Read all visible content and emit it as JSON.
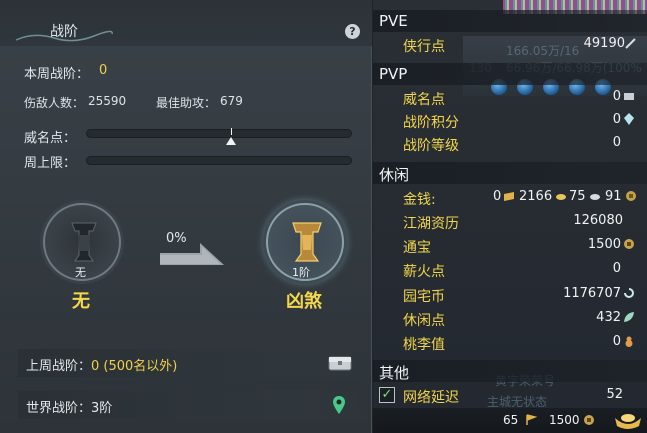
{
  "left": {
    "title": "战阶",
    "help_label": "?",
    "weekly_rank_label": "本周战阶：",
    "weekly_rank_value": "0",
    "damage_count_label": "伤敌人数：",
    "damage_count_value": "25590",
    "best_assist_label": "最佳助攻：",
    "best_assist_value": "679",
    "prestige_label": "威名点：",
    "prestige_level": 0.55,
    "weekly_cap_label": "周上限：",
    "weekly_cap_level": 0,
    "current_rank": {
      "sub": "无",
      "name": "无"
    },
    "next_rank": {
      "sub": "1阶",
      "name": "凶煞"
    },
    "progress_text": "0%",
    "last_week_label": "上周战阶：",
    "last_week_value": "0 (500名以外)",
    "world_rank_text": "世界战阶：3阶"
  },
  "right": {
    "pve_header": "PVE",
    "pve_rows": [
      {
        "label": "侠行点",
        "value": "49190"
      }
    ],
    "pvp_header": "PVP",
    "pvp_rows": [
      {
        "label": "威名点",
        "value": "0"
      },
      {
        "label": "战阶积分",
        "value": "0"
      },
      {
        "label": "战阶等级",
        "value": "0"
      }
    ],
    "leisure_header": "休闲",
    "money_label": "金钱:",
    "money_values": [
      "0",
      "2166",
      "75",
      "91"
    ],
    "leisure_rows": [
      {
        "label": "江湖资历",
        "value": "126080"
      },
      {
        "label": "通宝",
        "value": "1500"
      },
      {
        "label": "薪火点",
        "value": "0"
      },
      {
        "label": "园宅币",
        "value": "1176707"
      },
      {
        "label": "休闲点",
        "value": "432"
      },
      {
        "label": "桃李值",
        "value": "0"
      }
    ],
    "other_header": "其他",
    "network_label": "网络延迟",
    "network_value": "52",
    "network_checked": "✓",
    "bottom_count": "65",
    "bottom_tongbao": "1500",
    "ghost_texts": {
      "g1": "166.05万/16",
      "g2": "66.96万/66.98万(100%",
      "g3": "130",
      "g4": "黄字荣荣号",
      "g5": "主城无状态"
    }
  },
  "colors": {
    "accent_yellow": "#f2d04a",
    "label_yellow": "#f1d54b",
    "panel_bg": "#343b41"
  }
}
